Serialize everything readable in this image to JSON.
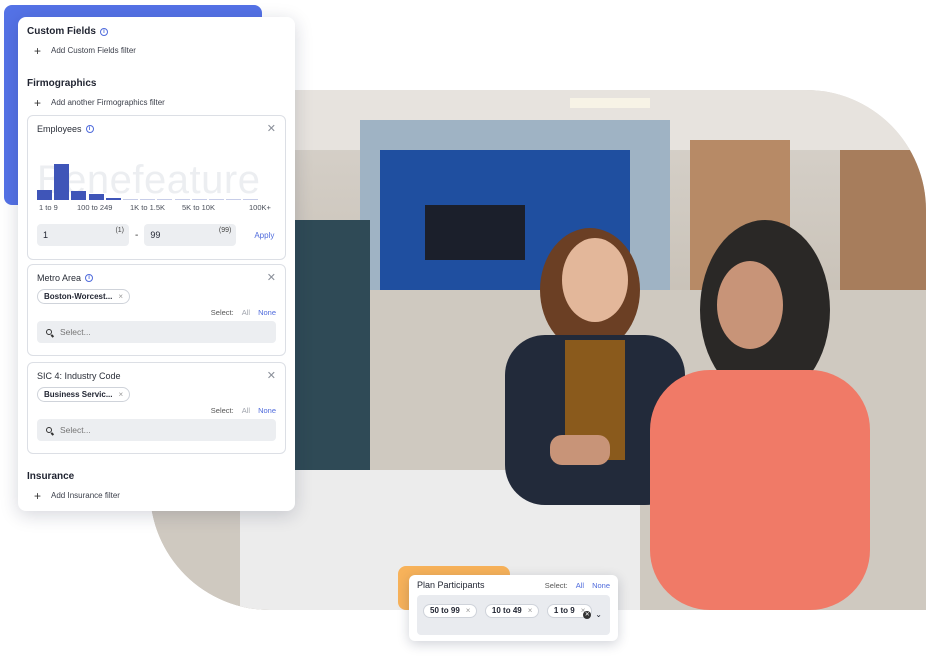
{
  "panel": {
    "custom_fields": {
      "title": "Custom Fields",
      "add_label": "Add Custom Fields filter"
    },
    "firmographics": {
      "title": "Firmographics",
      "add_label": "Add another Firmographics filter"
    },
    "employees": {
      "title": "Employees",
      "watermark": "Benefeature",
      "histogram": {
        "values": [
          0.28,
          1.0,
          0.25,
          0.16,
          0.06,
          0.04,
          0.03,
          0.02,
          0.02,
          0.02,
          0.02,
          0.01,
          0.01
        ],
        "labels": [
          "1 to 9",
          "100 to 249",
          "1K to 1.5K",
          "5K to 10K",
          "100K+"
        ]
      },
      "min_value": "1",
      "min_badge": "(1)",
      "max_value": "99",
      "max_badge": "(99)",
      "dash": "-",
      "apply_label": "Apply"
    },
    "metro_area": {
      "title": "Metro Area",
      "chip": "Boston-Worcest...",
      "select_label": "Select:",
      "all_label": "All",
      "none_label": "None",
      "search_placeholder": "Select..."
    },
    "sic4": {
      "title": "SIC 4: Industry Code",
      "chip": "Business Servic...",
      "select_label": "Select:",
      "all_label": "All",
      "none_label": "None",
      "search_placeholder": "Select..."
    },
    "insurance": {
      "title": "Insurance",
      "add_label": "Add Insurance filter"
    }
  },
  "plan": {
    "title": "Plan Participants",
    "select_label": "Select:",
    "all_label": "All",
    "none_label": "None",
    "chips": [
      "50 to 99",
      "10 to 49",
      "1 to 9"
    ]
  },
  "colors": {
    "accent_blue": "#5472e6",
    "accent_orange": "#f7b25a",
    "link": "#4f6bdc",
    "bar": "#3f55b8"
  }
}
